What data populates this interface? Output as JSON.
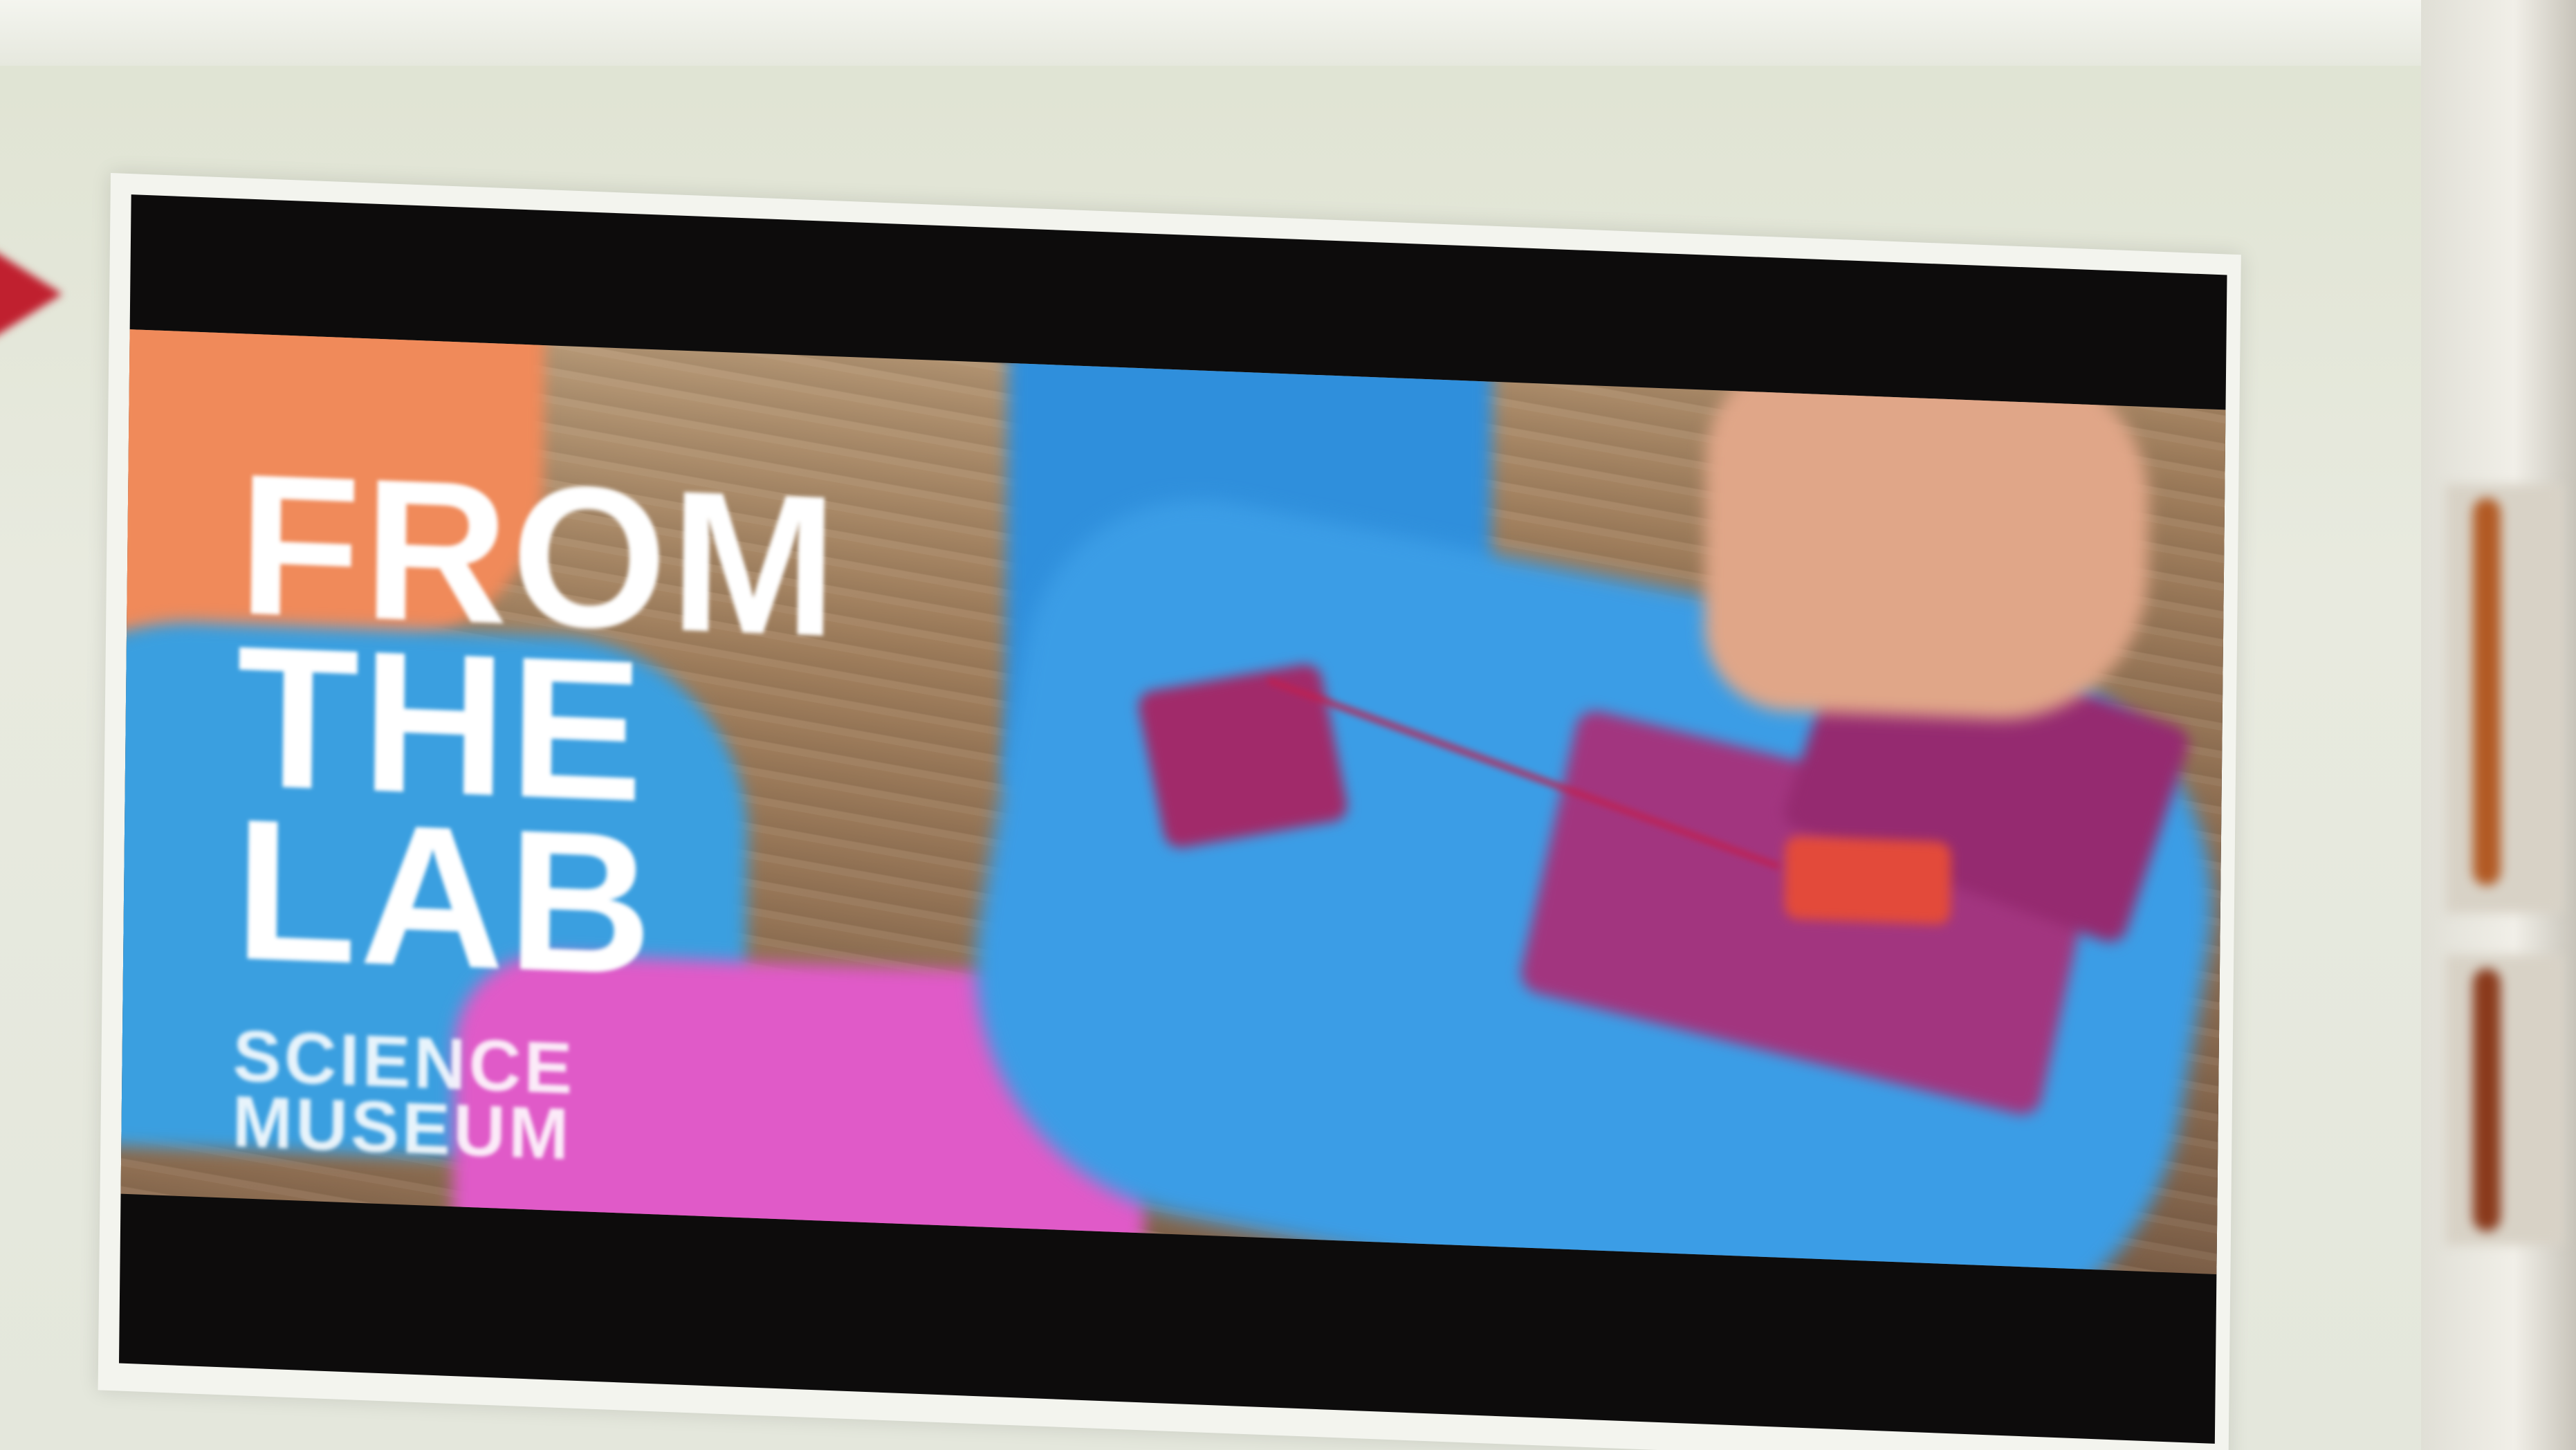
{
  "video": {
    "title_lines": [
      "FROM",
      "THE",
      "LAB"
    ],
    "brand_lines": [
      "SCIENCE",
      "MUSEUM"
    ]
  },
  "colors": {
    "arrow": "#c0202f",
    "sock_blue": "#3a9fe0",
    "sock_pink": "#e05ac8",
    "patch_purple": "#a2357f",
    "title_text": "#ffffff"
  }
}
